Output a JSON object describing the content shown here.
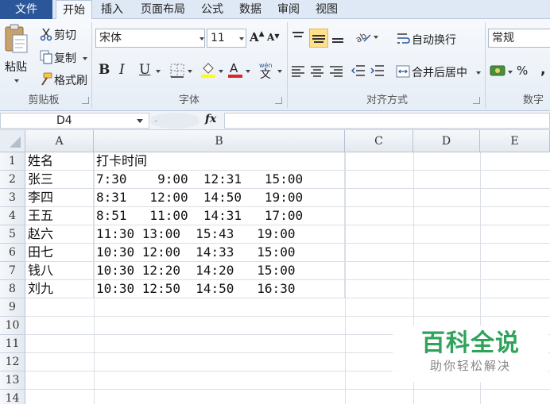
{
  "tabs": {
    "file": "文件",
    "home": "开始",
    "insert": "插入",
    "page_layout": "页面布局",
    "formulas": "公式",
    "data": "数据",
    "review": "审阅",
    "view": "视图"
  },
  "ribbon": {
    "clipboard": {
      "paste": "粘贴",
      "cut": "剪切",
      "copy": "复制",
      "format_painter": "格式刷",
      "label": "剪贴板"
    },
    "font": {
      "font_name": "宋体",
      "font_size": "11",
      "bold": "B",
      "italic": "I",
      "underline": "U",
      "label": "字体",
      "font_color": "#d9262a",
      "fill_color": "#ffff00"
    },
    "alignment": {
      "wrap_text": "自动换行",
      "merge_center": "合并后居中",
      "label": "对齐方式"
    },
    "number": {
      "format": "常规",
      "percent": "%",
      "comma": ",",
      "label": "数字"
    }
  },
  "formula_bar": {
    "name_box": "D4",
    "fx": "fx",
    "formula": ""
  },
  "sheet": {
    "columns": [
      "A",
      "B",
      "C",
      "D",
      "E"
    ],
    "rows": [
      "1",
      "2",
      "3",
      "4",
      "5",
      "6",
      "7",
      "8",
      "9",
      "10",
      "11",
      "12",
      "13",
      "14"
    ],
    "cells": [
      {
        "a": "姓名",
        "b": "打卡时间"
      },
      {
        "a": "张三",
        "b": "7:30    9:00  12:31   15:00"
      },
      {
        "a": "李四",
        "b": "8:31   12:00  14:50   19:00"
      },
      {
        "a": "王五",
        "b": "8:51   11:00  14:31   17:00"
      },
      {
        "a": "赵六",
        "b": "11:30 13:00  15:43   19:00"
      },
      {
        "a": "田七",
        "b": "10:30 12:00  14:33   15:00"
      },
      {
        "a": "钱八",
        "b": "10:30 12:20  14:20   15:00"
      },
      {
        "a": "刘九",
        "b": "10:30 12:50  14:50   16:30"
      }
    ]
  },
  "watermark": {
    "title": "百科全说",
    "subtitle": "助你轻松解决"
  }
}
